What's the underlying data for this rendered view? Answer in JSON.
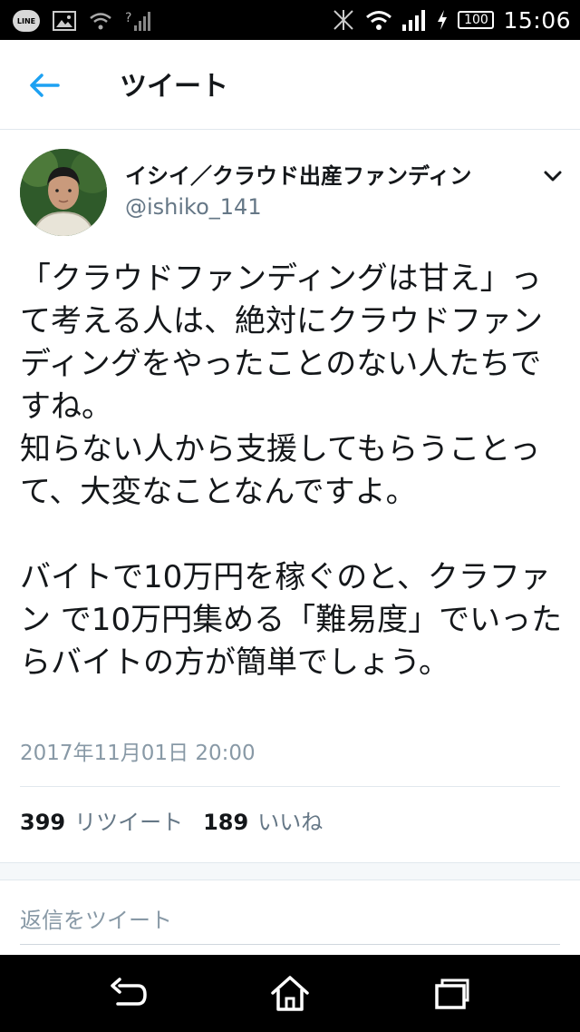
{
  "status_bar": {
    "time": "15:06",
    "battery": "100",
    "line_label": "LINE"
  },
  "app_bar": {
    "title": "ツイート"
  },
  "tweet": {
    "author_name": "イシイ／クラウド出産ファンディン",
    "author_handle": "@ishiko_141",
    "text": "「クラウドファンディングは甘え」って考える人は、絶対にクラウドファンディングをやったことのない人たちですね。\n知らない人から支援してもらうことって、大変なことなんですよ。\n\nバイトで10万円を稼ぐのと、クラファン で10万円集める「難易度」でいったらバイトの方が簡単でしょう。",
    "timestamp": "2017年11月01日 20:00",
    "retweet_count": "399",
    "retweet_label": "リツイート",
    "like_count": "189",
    "like_label": "いいね"
  },
  "reply": {
    "placeholder": "返信をツイート"
  },
  "colors": {
    "accent": "#1da1f2",
    "text": "#14171a",
    "secondary": "#657786"
  }
}
